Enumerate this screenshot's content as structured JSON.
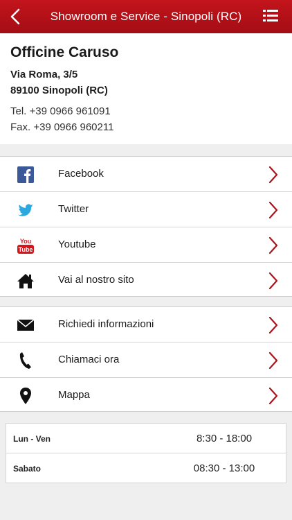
{
  "nav": {
    "title": "Showroom e Service - Sinopoli (RC)",
    "back_icon": "chevron-left-icon",
    "menu_icon": "list-menu-icon",
    "bar_color": "#b3111a"
  },
  "info": {
    "company": "Officine Caruso",
    "address_line1": "Via Roma, 3/5",
    "address_line2": "89100 Sinopoli (RC)",
    "tel": "Tel. +39 0966 961091",
    "fax": "Fax. +39 0966 960211"
  },
  "social": [
    {
      "label": "Facebook",
      "icon": "facebook-icon"
    },
    {
      "label": "Twitter",
      "icon": "twitter-icon"
    },
    {
      "label": "Youtube",
      "icon": "youtube-icon"
    },
    {
      "label": "Vai al nostro sito",
      "icon": "home-icon"
    }
  ],
  "actions": [
    {
      "label": "Richiedi informazioni",
      "icon": "mail-icon"
    },
    {
      "label": "Chiamaci ora",
      "icon": "phone-icon"
    },
    {
      "label": "Mappa",
      "icon": "map-pin-icon"
    }
  ],
  "hours": [
    {
      "day": "Lun - Ven",
      "time": "8:30 - 18:00"
    },
    {
      "day": "Sabato",
      "time": "08:30 - 13:00"
    }
  ],
  "accent_color": "#a8141c"
}
